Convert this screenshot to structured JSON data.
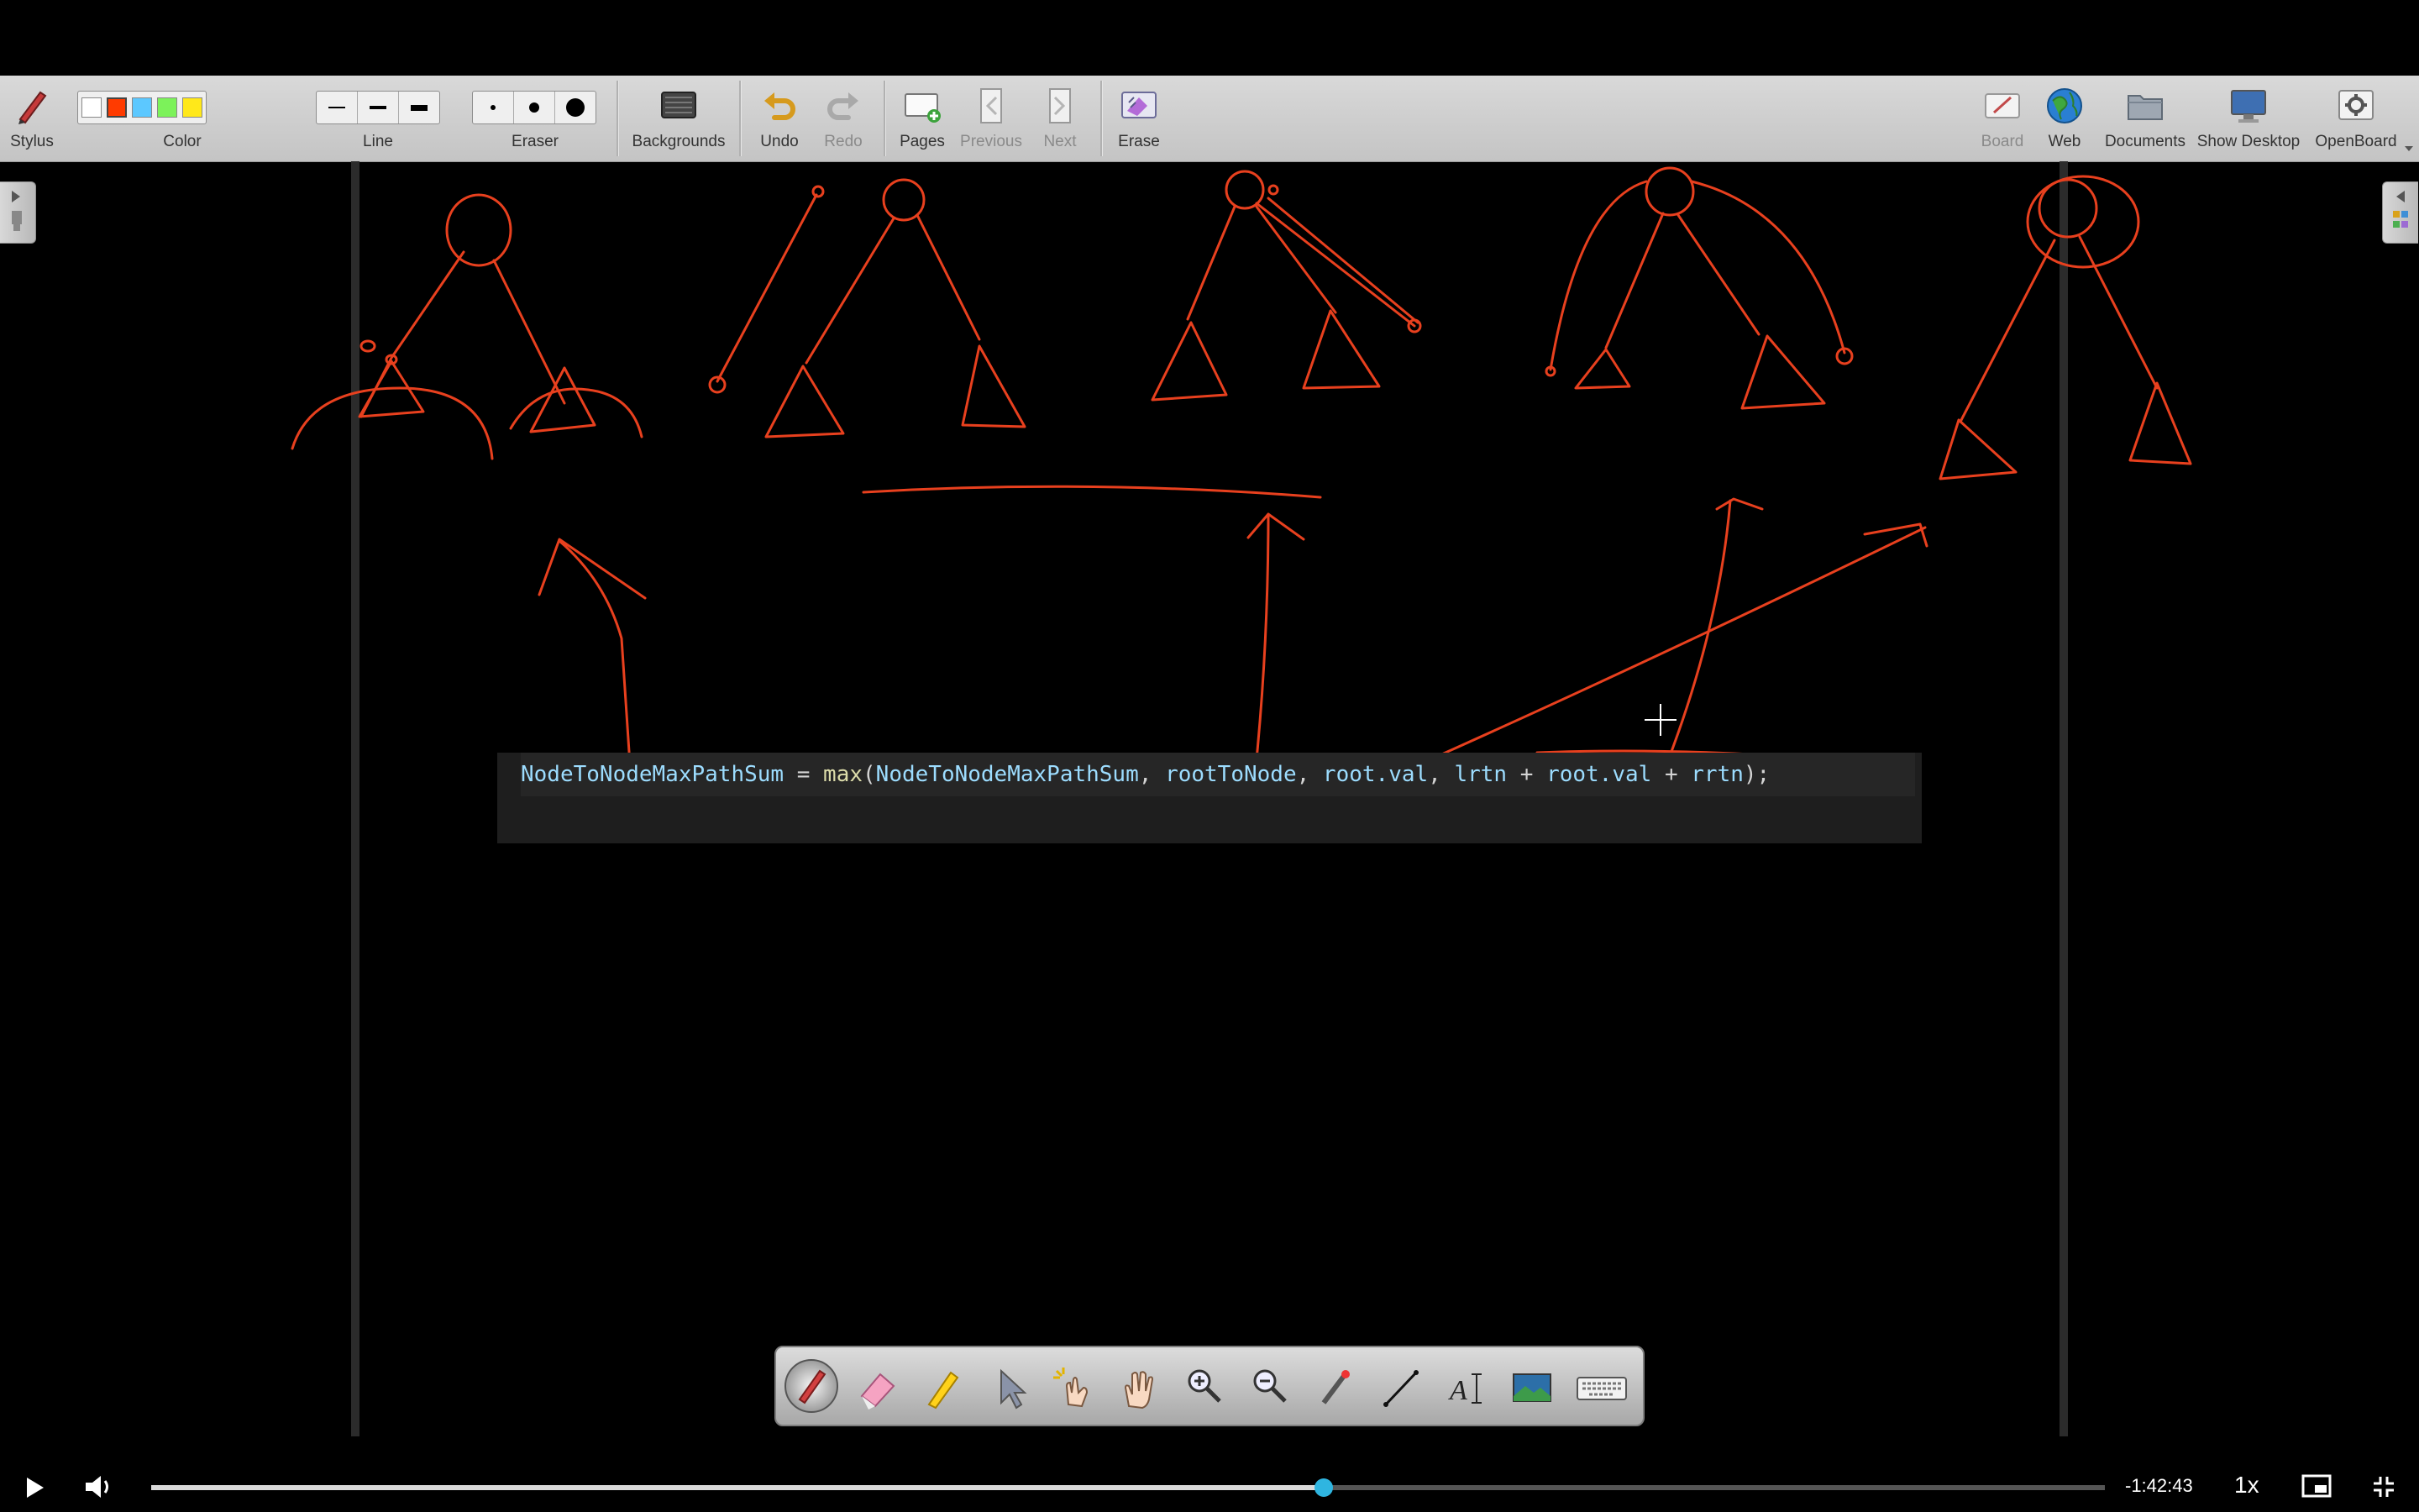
{
  "toolbar": {
    "stylus_label": "Stylus",
    "color_label": "Color",
    "line_label": "Line",
    "eraser_label": "Eraser",
    "backgrounds_label": "Backgrounds",
    "undo_label": "Undo",
    "redo_label": "Redo",
    "pages_label": "Pages",
    "previous_label": "Previous",
    "next_label": "Next",
    "erase_label": "Erase",
    "board_label": "Board",
    "web_label": "Web",
    "documents_label": "Documents",
    "show_desktop_label": "Show Desktop",
    "openboard_label": "OpenBoard",
    "colors": [
      "#ffffff",
      "#ff3b00",
      "#5cc8ff",
      "#7cf25a",
      "#ffe81a"
    ],
    "selected_color": "#ff3b00"
  },
  "code": {
    "tokens": [
      {
        "text": "NodeToNodeMaxPathSum",
        "kind": "var"
      },
      {
        "text": " = ",
        "kind": "op"
      },
      {
        "text": "max",
        "kind": "fn"
      },
      {
        "text": "(",
        "kind": "op"
      },
      {
        "text": "NodeToNodeMaxPathSum",
        "kind": "var"
      },
      {
        "text": ", ",
        "kind": "op"
      },
      {
        "text": "rootToNode",
        "kind": "var"
      },
      {
        "text": ", ",
        "kind": "op"
      },
      {
        "text": "root.val",
        "kind": "var"
      },
      {
        "text": ", ",
        "kind": "op"
      },
      {
        "text": "lrtn",
        "kind": "var"
      },
      {
        "text": " + ",
        "kind": "op"
      },
      {
        "text": "root.val",
        "kind": "var"
      },
      {
        "text": " + ",
        "kind": "op"
      },
      {
        "text": "rrtn",
        "kind": "var"
      },
      {
        "text": ");",
        "kind": "op"
      }
    ]
  },
  "palette": {
    "tools": [
      "pen-tool-icon",
      "eraser-tool-icon",
      "marker-tool-icon",
      "selector-tool-icon",
      "play-tool-icon",
      "hand-tool-icon",
      "zoom-in-tool-icon",
      "zoom-out-tool-icon",
      "laser-pointer-tool-icon",
      "line-tool-icon",
      "text-tool-icon",
      "capture-tool-icon",
      "keyboard-tool-icon"
    ],
    "active_tool": "pen-tool-icon"
  },
  "player": {
    "time_remaining": "-1:42:43",
    "speed": "1x",
    "progress_fraction": 0.6
  },
  "stroke_color": "#e8401e"
}
